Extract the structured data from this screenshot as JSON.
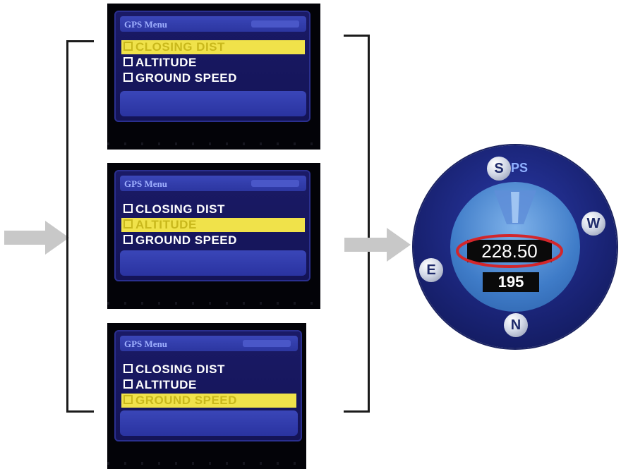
{
  "menu_screens": [
    {
      "title": "GPS Menu",
      "items": [
        {
          "label": "CLOSING DIST",
          "selected": true
        },
        {
          "label": "ALTITUDE",
          "selected": false
        },
        {
          "label": "GROUND SPEED",
          "selected": false
        }
      ]
    },
    {
      "title": "GPS Menu",
      "items": [
        {
          "label": "CLOSING DIST",
          "selected": false
        },
        {
          "label": "ALTITUDE",
          "selected": true
        },
        {
          "label": "GROUND SPEED",
          "selected": false
        }
      ]
    },
    {
      "title": "GPS Menu",
      "items": [
        {
          "label": "CLOSING DIST",
          "selected": false
        },
        {
          "label": "ALTITUDE",
          "selected": false
        },
        {
          "label": "GROUND SPEED",
          "selected": true
        }
      ]
    }
  ],
  "gps_display": {
    "label": "PS",
    "badges": {
      "top": "S",
      "right": "W",
      "left": "E",
      "bottom": "N"
    },
    "primary_value": "228.50",
    "secondary_value": "195"
  },
  "colors": {
    "highlight": "#f0e24a",
    "circle_annotation": "#d3262b",
    "arrow": "#c8c8c8"
  }
}
